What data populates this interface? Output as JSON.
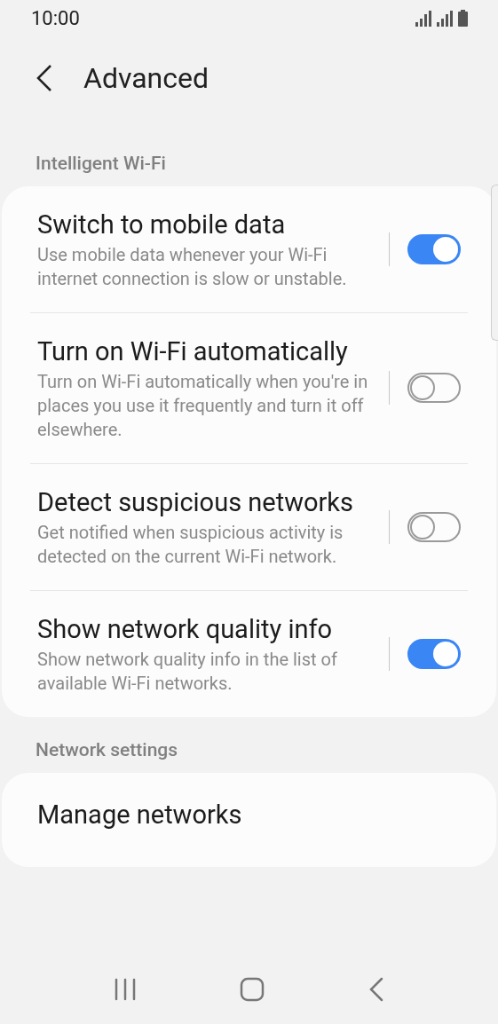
{
  "status_bar": {
    "time": "10:00"
  },
  "header": {
    "title": "Advanced"
  },
  "sections": [
    {
      "title": "Intelligent Wi-Fi",
      "items": [
        {
          "title": "Switch to mobile data",
          "description": "Use mobile data whenever your Wi-Fi internet connection is slow or unstable.",
          "on": true
        },
        {
          "title": "Turn on Wi-Fi automatically",
          "description": "Turn on Wi-Fi automatically when you're in places you use it frequently and turn it off elsewhere.",
          "on": false
        },
        {
          "title": "Detect suspicious networks",
          "description": "Get notified when suspicious activity is detected on the current Wi-Fi network.",
          "on": false
        },
        {
          "title": "Show network quality info",
          "description": "Show network quality info in the list of available Wi-Fi networks.",
          "on": true
        }
      ]
    },
    {
      "title": "Network settings",
      "items": [
        {
          "title": "Manage networks"
        }
      ]
    }
  ]
}
